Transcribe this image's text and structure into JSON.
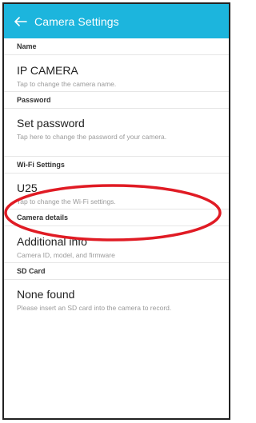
{
  "appbar": {
    "back_icon": "arrow-left-icon",
    "title": "Camera Settings"
  },
  "sections": {
    "name": {
      "header": "Name",
      "title": "IP CAMERA",
      "subtitle": "Tap to change the camera name."
    },
    "password": {
      "header": "Password",
      "title": "Set password",
      "subtitle": "Tap here to change the password of your camera."
    },
    "wifi": {
      "header": "Wi-Fi Settings",
      "title": "U25",
      "subtitle": "Tap to change the Wi-Fi settings."
    },
    "details": {
      "header": "Camera details",
      "title": "Additional info",
      "subtitle": "Camera ID, model, and firmware"
    },
    "sd": {
      "header": "SD Card",
      "title": "None found",
      "subtitle": "Please insert an SD card into the camera to record."
    }
  },
  "colors": {
    "appbar": "#1cb5dd",
    "annotation_circle": "#e01b24"
  }
}
